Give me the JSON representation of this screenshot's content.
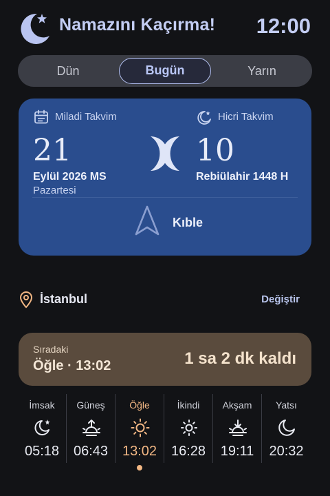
{
  "header": {
    "app_title": "Namazını Kaçırma!",
    "time": "12:00"
  },
  "tabs": [
    {
      "label": "Dün",
      "selected": false
    },
    {
      "label": "Bugün",
      "selected": true
    },
    {
      "label": "Yarın",
      "selected": false
    }
  ],
  "calendar": {
    "gregorian": {
      "label": "Miladi Takvim",
      "day": "21",
      "month_year": "Eylül 2026 MS",
      "weekday": "Pazartesi",
      "icon": "calendar-icon"
    },
    "hijri": {
      "label": "Hicri Takvim",
      "day": "10",
      "month_year": "Rebiülahir 1448 H",
      "icon": "crescent-star-icon"
    },
    "qibla": {
      "label": "Kıble",
      "icon": "navigation-arrow-icon"
    }
  },
  "location": {
    "city": "İstanbul",
    "change_label": "Değiştir",
    "icon": "location-pin-icon"
  },
  "next_prayer": {
    "label": "Sıradaki",
    "prayer": "Öğle · 13:02",
    "remaining": "1 sa 2 dk kaldı"
  },
  "prayer_times": [
    {
      "name": "İmsak",
      "time": "05:18",
      "icon": "moon-star-icon",
      "active": false
    },
    {
      "name": "Güneş",
      "time": "06:43",
      "icon": "sunrise-icon",
      "active": false
    },
    {
      "name": "Öğle",
      "time": "13:02",
      "icon": "sun-icon",
      "active": true
    },
    {
      "name": "İkindi",
      "time": "16:28",
      "icon": "sun-small-icon",
      "active": false
    },
    {
      "name": "Akşam",
      "time": "19:11",
      "icon": "sunset-icon",
      "active": false
    },
    {
      "name": "Yatsı",
      "time": "20:32",
      "icon": "moon-icon",
      "active": false
    }
  ],
  "colors": {
    "background": "#121316",
    "accent": "#c3cdf3",
    "calendar_card": "#2a4d8e",
    "next_card": "#5a4b3d",
    "active_prayer": "#f2b784"
  }
}
